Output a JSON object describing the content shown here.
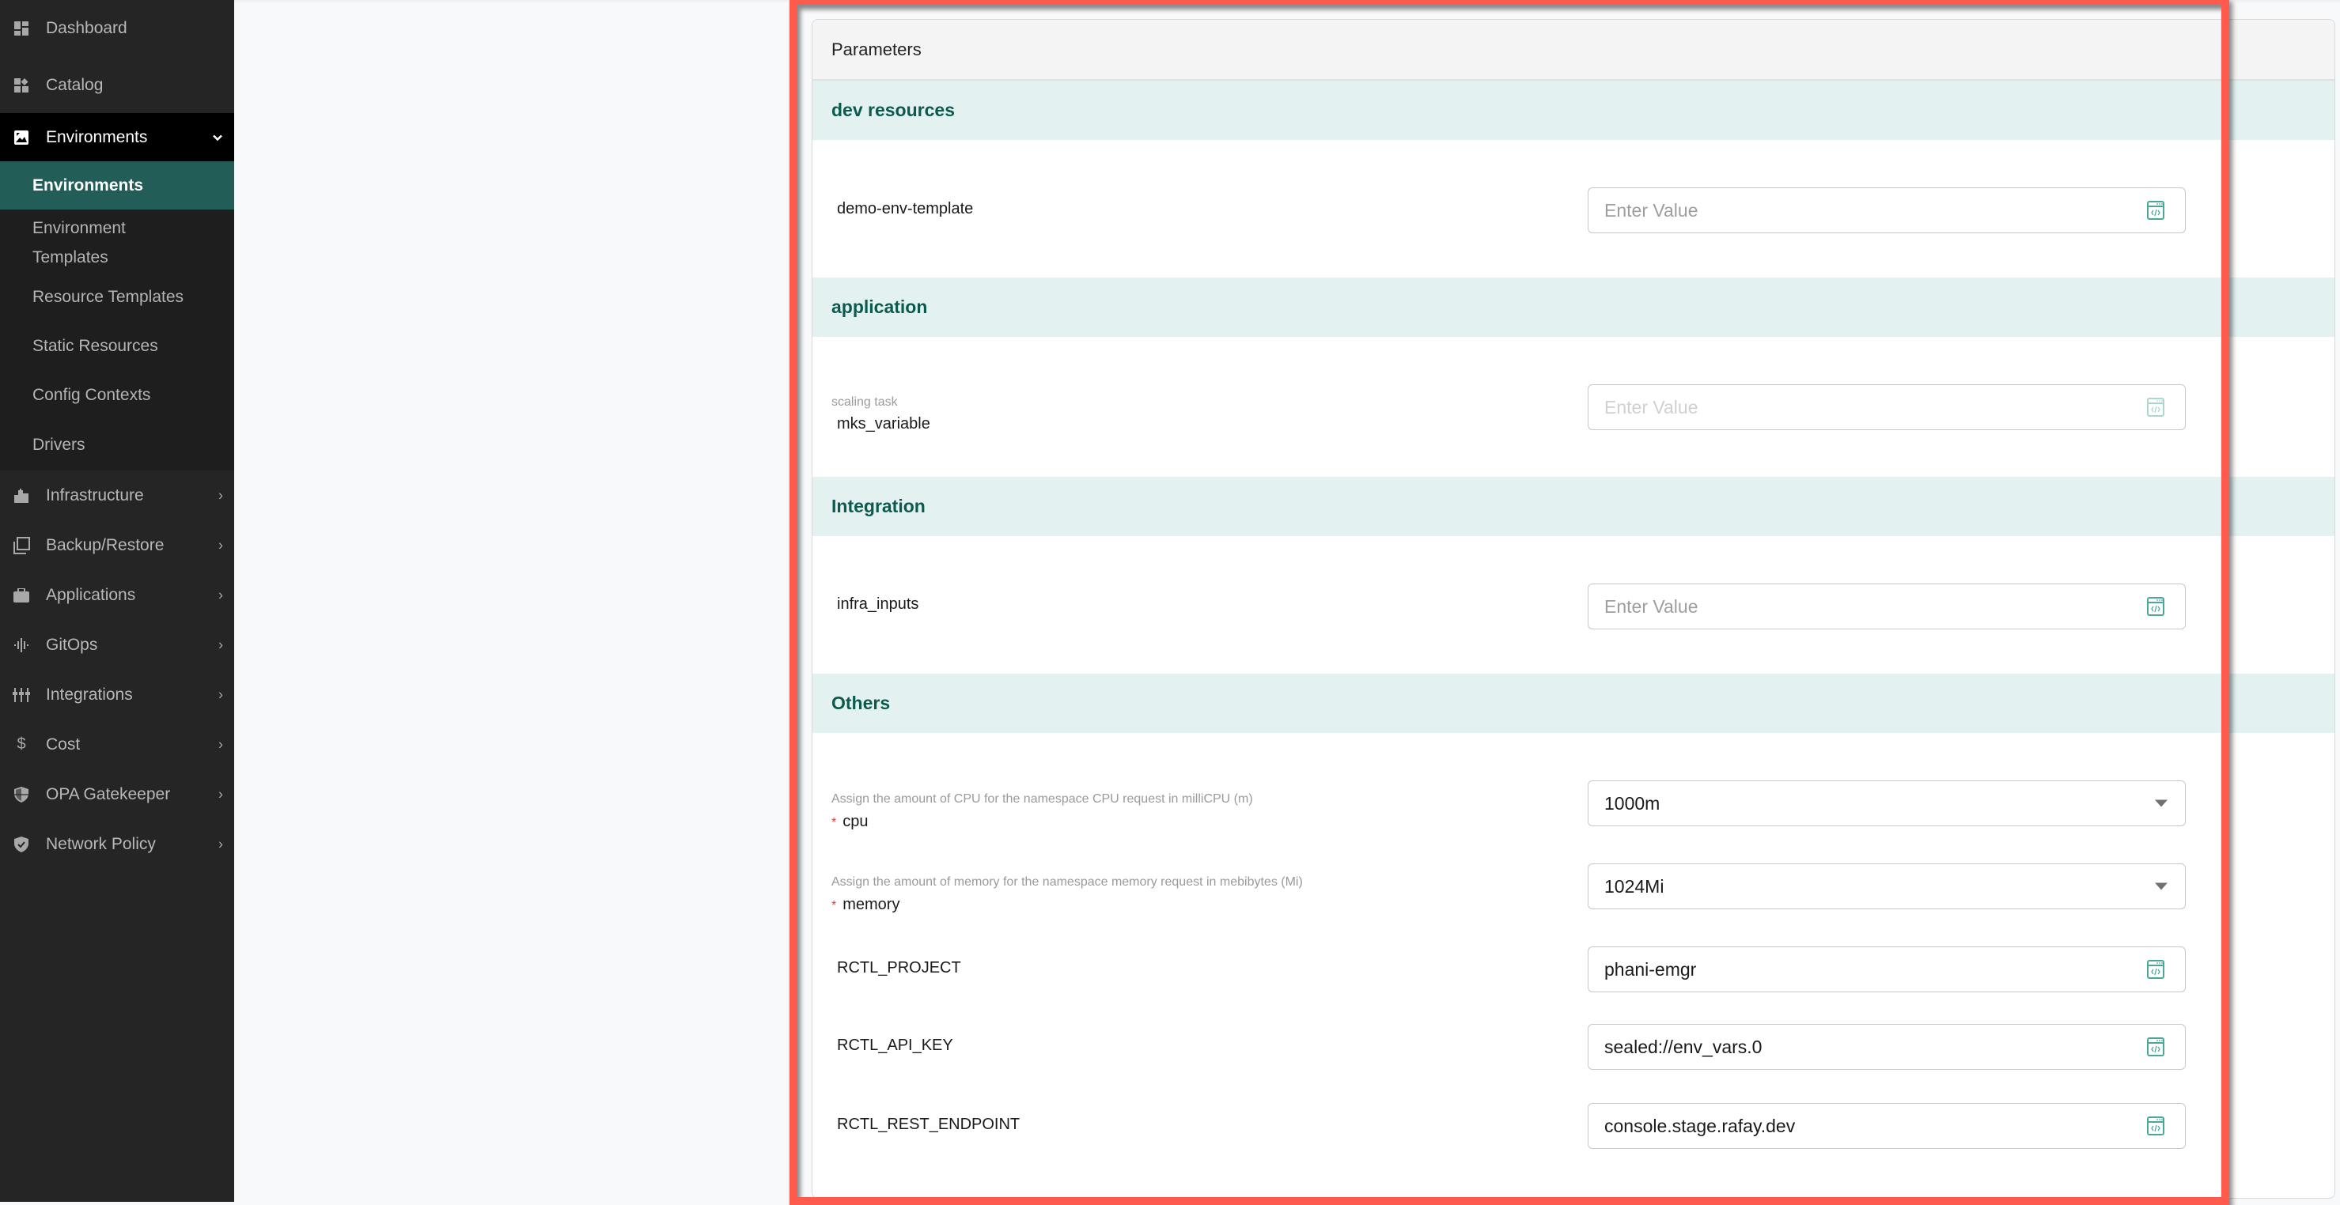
{
  "sidebar": {
    "items": [
      {
        "label": "Dashboard",
        "icon": "dashboard-icon"
      },
      {
        "label": "Catalog",
        "icon": "catalog-icon"
      },
      {
        "label": "Environments",
        "icon": "environments-icon",
        "expanded": true
      },
      {
        "label": "Infrastructure",
        "icon": "infrastructure-icon"
      },
      {
        "label": "Backup/Restore",
        "icon": "backup-restore-icon"
      },
      {
        "label": "Applications",
        "icon": "applications-icon"
      },
      {
        "label": "GitOps",
        "icon": "gitops-icon"
      },
      {
        "label": "Integrations",
        "icon": "integrations-icon"
      },
      {
        "label": "Cost",
        "icon": "cost-icon"
      },
      {
        "label": "OPA Gatekeeper",
        "icon": "opa-gatekeeper-icon"
      },
      {
        "label": "Network Policy",
        "icon": "network-policy-icon"
      }
    ],
    "environments_submenu": [
      {
        "label": "Environments",
        "active": true
      },
      {
        "label": "Environment Templates"
      },
      {
        "label": "Resource Templates"
      },
      {
        "label": "Static Resources"
      },
      {
        "label": "Config Contexts"
      },
      {
        "label": "Drivers"
      }
    ]
  },
  "parameters": {
    "title": "Parameters",
    "sections": [
      {
        "title": "dev resources",
        "fields": [
          {
            "name": "demo-env-template",
            "placeholder": "Enter Value",
            "value": ""
          }
        ]
      },
      {
        "title": "application",
        "fields": [
          {
            "name": "mks_variable",
            "description": "scaling task",
            "placeholder": "Enter Value",
            "value": "",
            "disabled": true
          }
        ]
      },
      {
        "title": "Integration",
        "fields": [
          {
            "name": "infra_inputs",
            "placeholder": "Enter Value",
            "value": ""
          }
        ]
      },
      {
        "title": "Others",
        "fields": [
          {
            "name": "cpu",
            "required": true,
            "required_mark": "*",
            "description": "Assign the amount of CPU for the namespace CPU request in milliCPU (m)",
            "type": "select",
            "value": "1000m"
          },
          {
            "name": "memory",
            "required": true,
            "required_mark": "*",
            "description": "Assign the amount of memory for the namespace memory request in mebibytes (Mi)",
            "type": "select",
            "value": "1024Mi"
          },
          {
            "name": "RCTL_PROJECT",
            "value": "phani-emgr"
          },
          {
            "name": "RCTL_API_KEY",
            "value": "sealed://env_vars.0"
          },
          {
            "name": "RCTL_REST_ENDPOINT",
            "value": "console.stage.rafay.dev"
          }
        ]
      }
    ]
  },
  "colors": {
    "accent": "#225d58",
    "section_bg": "#e3f2f1",
    "section_text": "#0c5a4e",
    "annotation": "#ff5a4e",
    "required": "#e53935",
    "icon_accent": "#4aa89a"
  }
}
